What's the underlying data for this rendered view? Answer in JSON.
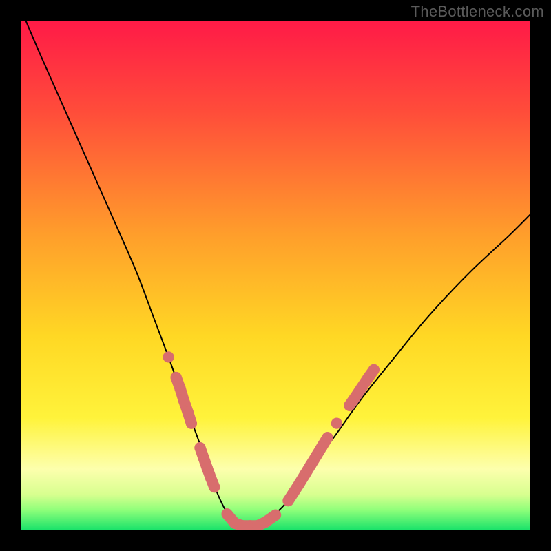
{
  "watermark": "TheBottleneck.com",
  "chart_data": {
    "type": "line",
    "title": "",
    "xlabel": "",
    "ylabel": "",
    "xlim": [
      0,
      100
    ],
    "ylim": [
      0,
      100
    ],
    "grid": false,
    "legend": false,
    "background_gradient": {
      "stops": [
        {
          "offset": 0.0,
          "color": "#ff1a47"
        },
        {
          "offset": 0.18,
          "color": "#ff4d3a"
        },
        {
          "offset": 0.42,
          "color": "#ff9e2b"
        },
        {
          "offset": 0.62,
          "color": "#ffd824"
        },
        {
          "offset": 0.78,
          "color": "#fff33b"
        },
        {
          "offset": 0.88,
          "color": "#fdffad"
        },
        {
          "offset": 0.93,
          "color": "#d7ff8f"
        },
        {
          "offset": 0.96,
          "color": "#8fff7a"
        },
        {
          "offset": 1.0,
          "color": "#17e26a"
        }
      ]
    },
    "series": [
      {
        "name": "bottleneck-curve",
        "color": "#000000",
        "x": [
          1,
          4,
          8,
          12,
          16,
          20,
          23,
          26,
          29,
          31.5,
          33.5,
          35.5,
          37,
          38.5,
          40,
          41.5,
          43,
          47,
          49,
          52,
          55,
          58,
          62,
          67,
          73,
          80,
          88,
          96,
          100
        ],
        "y": [
          100,
          93,
          84,
          75,
          66,
          57,
          50,
          42,
          34,
          27,
          21.5,
          16,
          11.5,
          7.5,
          4.3,
          2.2,
          1.0,
          1.0,
          2.4,
          5.3,
          9.2,
          13.5,
          19,
          26,
          33.5,
          42,
          50.5,
          58,
          62
        ]
      }
    ],
    "markers": {
      "name": "highlight-dots",
      "color": "#d86d6d",
      "radius": 1.1,
      "points": [
        {
          "x": 29.0,
          "y": 34.0
        },
        {
          "x": 30.5,
          "y": 30.0
        },
        {
          "x": 31.3,
          "y": 27.8
        },
        {
          "x": 32.0,
          "y": 25.5
        },
        {
          "x": 32.8,
          "y": 23.2
        },
        {
          "x": 33.5,
          "y": 21.0
        },
        {
          "x": 35.2,
          "y": 16.2
        },
        {
          "x": 35.9,
          "y": 14.2
        },
        {
          "x": 36.6,
          "y": 12.2
        },
        {
          "x": 37.3,
          "y": 10.3
        },
        {
          "x": 38.0,
          "y": 8.5
        },
        {
          "x": 40.5,
          "y": 3.2
        },
        {
          "x": 42.0,
          "y": 1.4
        },
        {
          "x": 43.5,
          "y": 0.9
        },
        {
          "x": 45.0,
          "y": 0.9
        },
        {
          "x": 46.5,
          "y": 0.9
        },
        {
          "x": 48.0,
          "y": 1.6
        },
        {
          "x": 50.0,
          "y": 3.0
        },
        {
          "x": 52.5,
          "y": 5.8
        },
        {
          "x": 53.6,
          "y": 7.5
        },
        {
          "x": 54.7,
          "y": 9.2
        },
        {
          "x": 55.8,
          "y": 11.0
        },
        {
          "x": 56.9,
          "y": 12.8
        },
        {
          "x": 58.0,
          "y": 14.6
        },
        {
          "x": 59.1,
          "y": 16.4
        },
        {
          "x": 60.2,
          "y": 18.2
        },
        {
          "x": 62.0,
          "y": 21.0
        },
        {
          "x": 64.5,
          "y": 24.5
        },
        {
          "x": 65.7,
          "y": 26.2
        },
        {
          "x": 66.9,
          "y": 28.0
        },
        {
          "x": 68.1,
          "y": 29.8
        },
        {
          "x": 69.3,
          "y": 31.5
        }
      ]
    }
  }
}
